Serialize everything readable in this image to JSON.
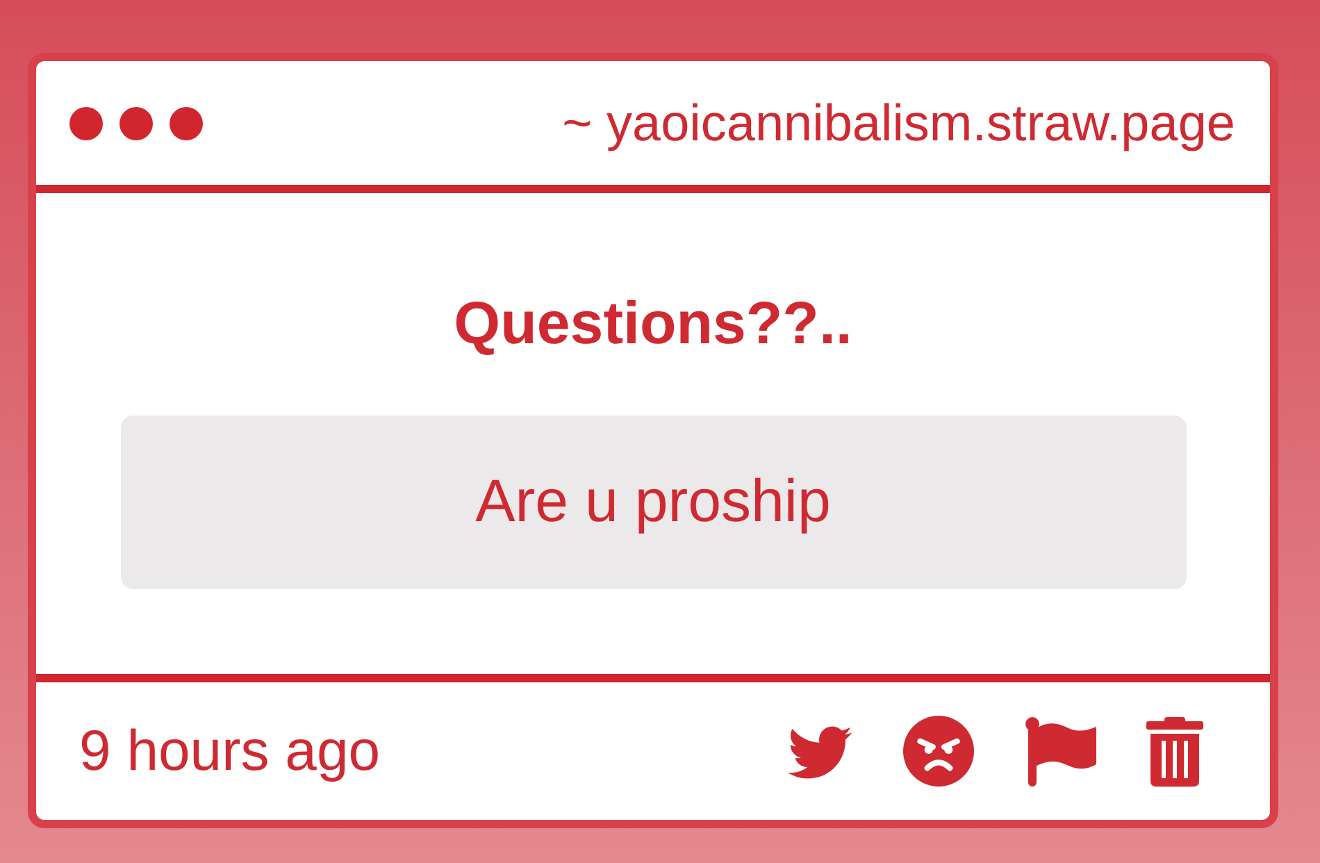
{
  "window": {
    "address": "~ yaoicannibalism.straw.page"
  },
  "question": {
    "title": "Questions??..",
    "text": "Are u proship"
  },
  "footer": {
    "time": "9 hours ago"
  }
}
